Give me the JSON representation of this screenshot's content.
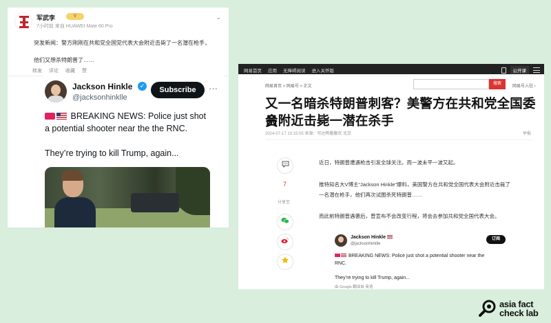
{
  "weibo": {
    "user_name": "军武李",
    "badge": "V",
    "meta": "7小时前 来自 HUAWEI Mate 60 Pro",
    "text_line1": "突发新闻：警方刚刚在共和党全国党代表大会附近击毙了一名潜在枪手，",
    "text_line2": "他们又想杀特朗普了……",
    "actions": [
      "转发",
      "评论",
      "收藏",
      "赞"
    ],
    "chevron": "⌄"
  },
  "tweet": {
    "name": "Jackson Hinkle",
    "handle": "@jacksonhinklle",
    "subscribe_label": "Subscribe",
    "more": "···",
    "line1": "BREAKING NEWS: Police just shot",
    "line2": "a potential shooter near the the RNC.",
    "line3": "They’re trying to kill Trump, again..."
  },
  "netease": {
    "topbar_links": [
      "网易首页",
      "应用",
      "无障碍阅读",
      "进入关怀版"
    ],
    "public_account": "公开课",
    "breadcrumb": "网易首页 > 网易号 > 正文",
    "search_button": "搜索",
    "home_link": "网易号入驻 ›",
    "title_line1": "又一名暗杀特朗普刺客？美警方在共和党全国委员",
    "title_line2": "会附近击毙一潜在杀手",
    "meta": "2024-07-17 10:15:05  来源：可达鸭撒撒欢  北京",
    "report": "举报",
    "comment_count": "7",
    "share_label": "分享至",
    "para1": "近日，特朗普遭遇枪击引发全球关注。而一波未平一波又起。",
    "para2a": "推特知名大V博主“Jackson Hinkle”爆料，美国警方在共和党全国代表大会附近击毙了",
    "para2b": "一名潜在枪手，他们再次试图杀死特朗普……",
    "para3": "而此前特朗普遇袭后，曾宣布不会改变行程，将会去参加共和党全国代表大会。",
    "embed": {
      "name": "Jackson Hinkle",
      "handle": "@jacksonhinklle",
      "follow_label": "订阅",
      "line1": "BREAKING NEWS: Police just shot a potential shooter near the",
      "line2": "RNC.",
      "line3": "They’re trying to kill Trump, again...",
      "foot": "由 Google 翻译自 英语"
    }
  },
  "logo": {
    "line1": "asia fact",
    "line2": "check lab"
  },
  "colors": {
    "background": "#d9eedd",
    "twitter_blue": "#1d9bf0",
    "netease_red": "#dd3333"
  }
}
